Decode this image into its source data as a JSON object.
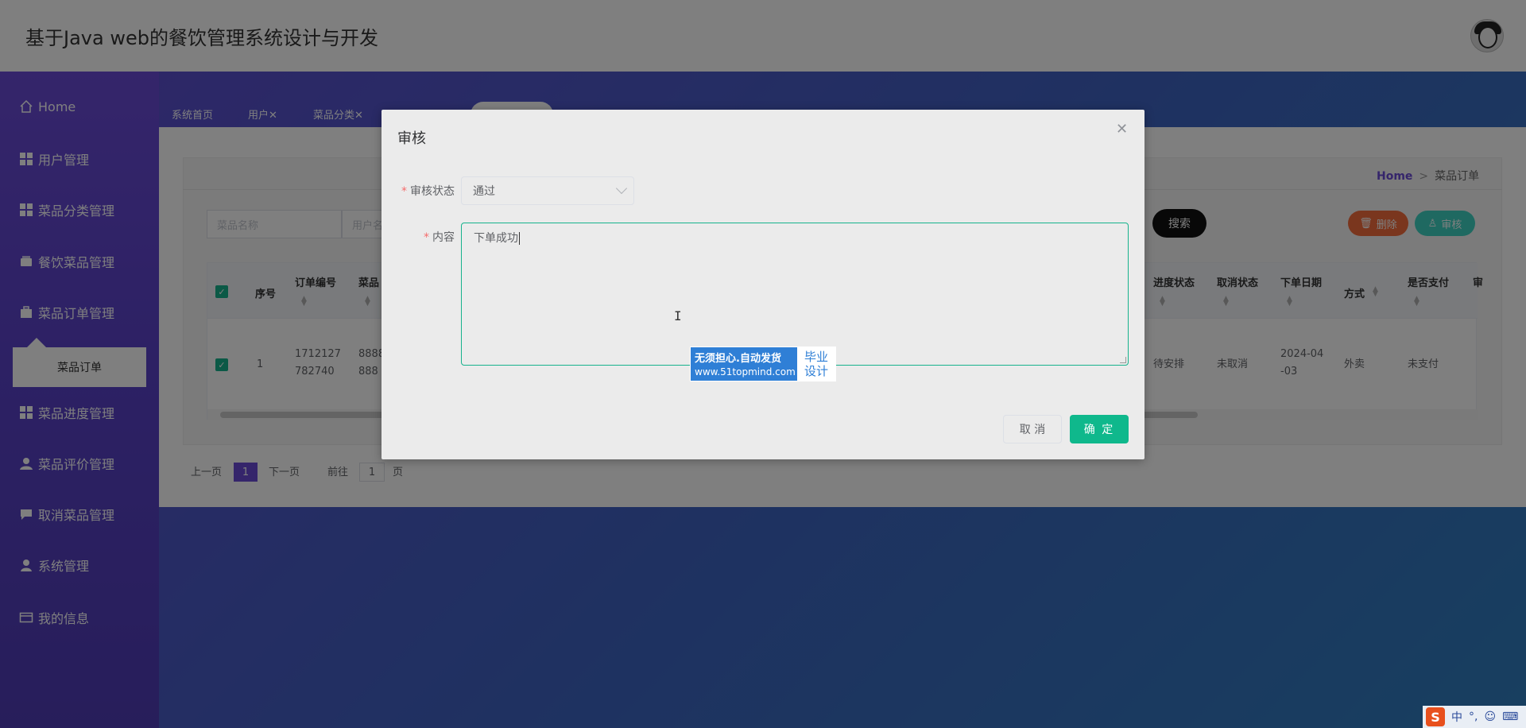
{
  "app": {
    "title": "基于Java web的餐饮管理系统设计与开发"
  },
  "sidebar": {
    "items": [
      {
        "label": "Home",
        "icon": "home-icon"
      },
      {
        "label": "用户管理",
        "icon": "grid-icon"
      },
      {
        "label": "菜品分类管理",
        "icon": "grid-icon"
      },
      {
        "label": "餐饮菜品管理",
        "icon": "wallet-icon"
      },
      {
        "label": "菜品订单管理",
        "icon": "briefcase-icon"
      },
      {
        "label": "菜品进度管理",
        "icon": "grid-icon"
      },
      {
        "label": "菜品评价管理",
        "icon": "user-icon"
      },
      {
        "label": "取消菜品管理",
        "icon": "chat-icon"
      },
      {
        "label": "系统管理",
        "icon": "user-icon"
      },
      {
        "label": "我的信息",
        "icon": "card-icon"
      }
    ],
    "submenu_label": "菜品订单"
  },
  "tabs": [
    "系统首页",
    "用户✕",
    "菜品分类✕"
  ],
  "breadcrumb": {
    "home": "Home",
    "separator": ">",
    "current": "菜品订单"
  },
  "search": {
    "name_placeholder": "菜品名称",
    "user_placeholder": "用户名",
    "search_label": "搜索"
  },
  "actions": {
    "delete_label": "删除",
    "audit_label": "审核"
  },
  "table": {
    "headers": [
      "序号",
      "订单编号",
      "菜品",
      "进度状态",
      "取消状态",
      "下单日期",
      "方式",
      "是否支付",
      "审"
    ],
    "row": {
      "index": "1",
      "order_no_1": "1712127",
      "order_no_2": "782740",
      "dish_1": "8888",
      "dish_2": "888",
      "progress": "待安排",
      "cancel": "未取消",
      "date_1": "2024-04",
      "date_2": "-03",
      "method": "外卖",
      "paid": "未支付"
    }
  },
  "pager": {
    "prev": "上一页",
    "current": "1",
    "next": "下一页",
    "goto": "前往",
    "goto_value": "1",
    "page_unit": "页"
  },
  "dialog": {
    "title": "审核",
    "status_label": "审核状态",
    "status_value": "通过",
    "content_label": "内容",
    "content_value": "下单成功",
    "cancel_label": "取 消",
    "ok_label": "确 定"
  },
  "watermark": {
    "line1": "无须担心.自动发货",
    "line2": "www.51topmind.com",
    "right1": "毕业",
    "right2": "设计"
  },
  "ime": {
    "logo": "S",
    "lang": "中",
    "punct": "°,",
    "emoji": "☺",
    "keyboard": "⌨"
  },
  "colors": {
    "accent": "#6a4bd6",
    "confirm": "#0fb88c",
    "delete": "#f56c3c",
    "audit": "#3fd3c3"
  }
}
